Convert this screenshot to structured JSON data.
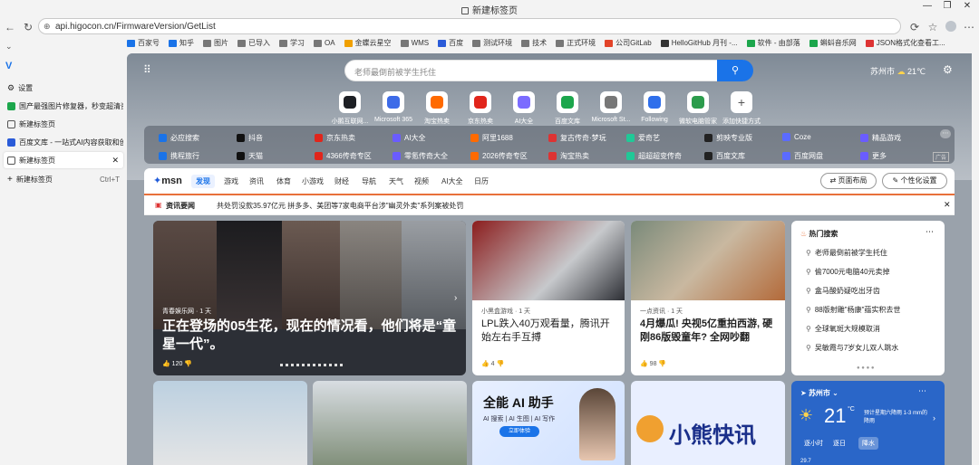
{
  "window": {
    "title": "新建标签页"
  },
  "address": {
    "url": "api.higocon.cn/FirmwareVersion/GetList"
  },
  "bookmarks": [
    "百家号",
    "知乎",
    "图片",
    "已导入",
    "学习",
    "OA",
    "金蝶云星空",
    "WMS",
    "百度",
    "测试环境",
    "技术",
    "正式环境",
    "公司GitLab",
    "HelloGitHub 月刊 -...",
    "软件 - 由部落",
    "蝌蚪音乐网",
    "JSON格式化查看工..."
  ],
  "sidebar": {
    "settings": "设置",
    "tabs": [
      "国产最强图片修复器，秒变超清资源...",
      "新建标签页",
      "百度文库 - 一站式AI内容获取和创作平台",
      "新建标签页"
    ],
    "new_tab": "新建标签页",
    "new_tab_shortcut": "Ctrl+T"
  },
  "search": {
    "placeholder": "老师最倒前被学生托住"
  },
  "weather_top": {
    "city": "苏州市",
    "temp": "21℃"
  },
  "tiles": [
    "小鹅互联网...",
    "Microsoft 365",
    "淘宝热卖",
    "京东热卖",
    "AI大全",
    "百度文库",
    "Microsoft St...",
    "Following",
    "微软电脑管家",
    "添加快捷方式"
  ],
  "quicklinks": [
    [
      "必应搜索",
      "抖音",
      "京东热卖",
      "AI大全",
      "阿里1688",
      "复古传奇·梦玩",
      "爱奇艺",
      "剪映专业版",
      "Coze",
      "精品游戏"
    ],
    [
      "携程旅行",
      "天猫",
      "4366传奇专区",
      "零氪传奇大全",
      "2026传奇专区",
      "淘宝热卖",
      "超超超变传奇",
      "百度文库",
      "百度网盘",
      "更多"
    ]
  ],
  "ad_badge": "广告",
  "msn": {
    "logo": "msn",
    "tabs": [
      "发现",
      "游戏",
      "资讯",
      "体育",
      "小游戏",
      "财经",
      "导航",
      "天气",
      "视频",
      "AI大全",
      "日历"
    ],
    "layout_btn": "页面布局",
    "personalize_btn": "个性化设置"
  },
  "newsbar": {
    "label": "资讯要闻",
    "text": "共处罚没款35.97亿元 拼多多、美团等7家电商平台涉\"幽灵外卖\"系列案被处罚"
  },
  "card_main": {
    "source": "青春娱乐网 · 1 天",
    "title": "正在登场的05生花，现在的情况看，他们将是“童星一代”。",
    "likes": "120"
  },
  "card2": {
    "source": "小黑盒游戏 · 1 天",
    "title": "LPL跌入40万观看量，腾讯开始左右手互搏",
    "likes": "4"
  },
  "card3": {
    "source": "一点资讯 · 1 天",
    "title": "4月爆瓜! 央视5亿重拍西游, 硬刚86版毁童年? 全网吵翻",
    "likes": "98"
  },
  "hot": {
    "title": "热门搜索",
    "items": [
      "老师最倒前被学生托住",
      "偷7000元电脑40元卖掉",
      "盒马酸奶疑吃出牙齿",
      "88版射雕\"杨康\"蕴实积去世",
      "全球氧斑大规模取消",
      "吴敏霞与7岁女儿双人跳水"
    ]
  },
  "ai_card": {
    "title": "全能 AI 助手",
    "subtitle": "AI 搜索 | AI 生图 | AI 写作",
    "btn": "立即体验"
  },
  "bear_card": {
    "title": "小熊快讯"
  },
  "weather": {
    "city": "苏州市",
    "temp": "21",
    "unit": "°C",
    "desc": "预计星期六降雨 1-3 mm的降雨",
    "tabs": [
      "逐小时",
      "逐日",
      "降水"
    ],
    "bottom": "29.7"
  },
  "colors": {
    "accent": "#1a73e8",
    "msn_blue": "#1f5bd9"
  }
}
